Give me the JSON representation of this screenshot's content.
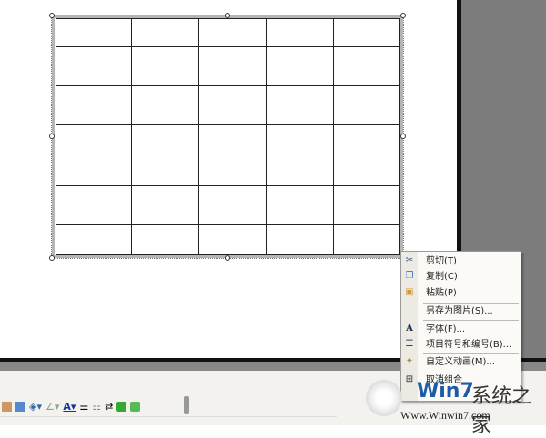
{
  "context_menu": {
    "items": [
      {
        "label": "剪切(T)",
        "icon": "scissors-icon"
      },
      {
        "label": "复制(C)",
        "icon": "copy-icon"
      },
      {
        "label": "粘贴(P)",
        "icon": "paste-icon"
      },
      {
        "label": "另存为图片(S)...",
        "icon": ""
      },
      {
        "label": "字体(F)...",
        "icon": "font-icon"
      },
      {
        "label": "项目符号和编号(B)...",
        "icon": "bullets-icon"
      },
      {
        "label": "自定义动画(M)...",
        "icon": "animation-icon"
      },
      {
        "label": "取消组合",
        "icon": "ungroup-icon"
      }
    ]
  },
  "watermark": {
    "brand": "Win7",
    "name": "系统之家",
    "url": "Www.Winwin7.com"
  },
  "table": {
    "columns": 5,
    "rows": 6
  }
}
